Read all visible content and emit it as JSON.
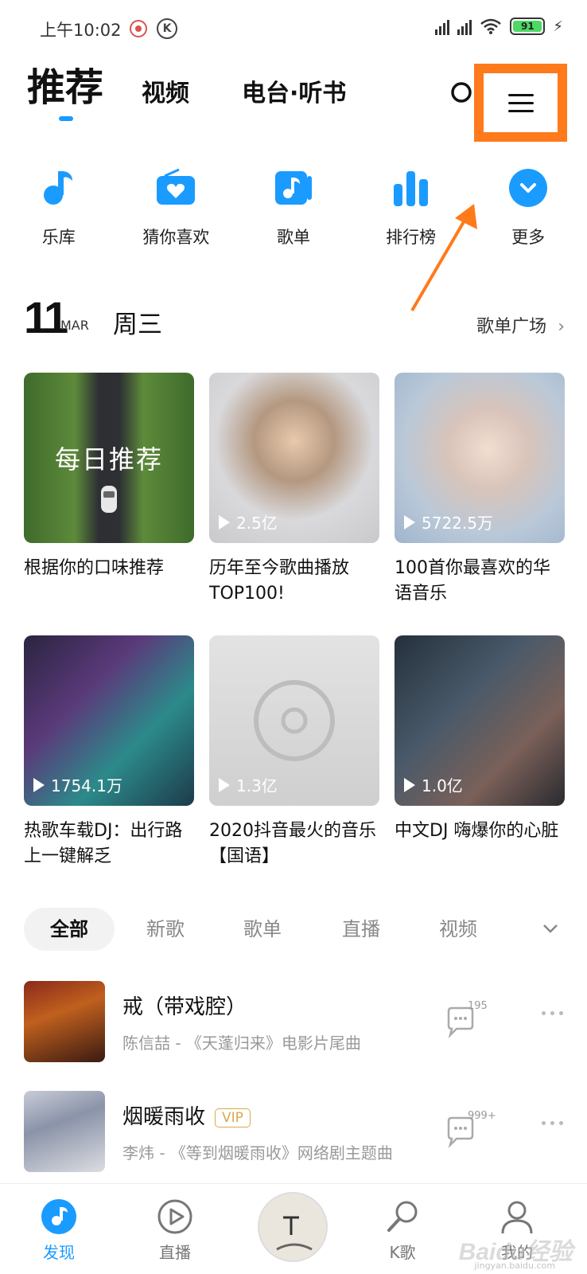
{
  "status_bar": {
    "time": "上午10:02",
    "battery": "91",
    "k_badge": "K"
  },
  "header": {
    "tabs": [
      {
        "label": "推荐",
        "active": true
      },
      {
        "label": "视频",
        "active": false
      },
      {
        "label": "电台·听书",
        "active": false
      }
    ],
    "highlight_color": "#ff7a1a"
  },
  "quick_entries": [
    {
      "label": "乐库",
      "icon": "music-note-icon"
    },
    {
      "label": "猜你喜欢",
      "icon": "radio-heart-icon"
    },
    {
      "label": "歌单",
      "icon": "playlist-icon"
    },
    {
      "label": "排行榜",
      "icon": "bar-chart-icon"
    },
    {
      "label": "更多",
      "icon": "chevron-down-circle-icon"
    }
  ],
  "date": {
    "day": "11",
    "month": "MAR",
    "weekday": "周三",
    "plaza_link": "歌单广场"
  },
  "playlists": [
    {
      "title": "根据你的口味推荐",
      "overlay_text": "每日推荐",
      "play_count": ""
    },
    {
      "title": "历年至今歌曲播放TOP100!",
      "play_count": "2.5亿"
    },
    {
      "title": "100首你最喜欢的华语音乐",
      "play_count": "5722.5万"
    },
    {
      "title": "热歌车载DJ：出行路上一键解乏",
      "play_count": "1754.1万"
    },
    {
      "title": "2020抖音最火的音乐【国语】",
      "play_count": "1.3亿"
    },
    {
      "title": "中文DJ 嗨爆你的心脏",
      "play_count": "1.0亿"
    }
  ],
  "filter_tabs": [
    {
      "label": "全部",
      "active": true
    },
    {
      "label": "新歌",
      "active": false
    },
    {
      "label": "歌单",
      "active": false
    },
    {
      "label": "直播",
      "active": false
    },
    {
      "label": "视频",
      "active": false
    }
  ],
  "songs": [
    {
      "name": "戒（带戏腔）",
      "subtitle": "陈信喆 - 《天蓬归来》电影片尾曲",
      "comments": "195",
      "vip": false
    },
    {
      "name": "烟暖雨收",
      "subtitle": "李炜 - 《等到烟暖雨收》网络剧主题曲",
      "comments": "999+",
      "vip": true,
      "vip_label": "VIP"
    }
  ],
  "bottom_nav": [
    {
      "label": "发现",
      "icon": "discover-icon",
      "active": true
    },
    {
      "label": "直播",
      "icon": "live-play-icon",
      "active": false
    },
    {
      "label": "K歌",
      "icon": "microphone-icon",
      "active": false
    },
    {
      "label": "我的",
      "icon": "profile-icon",
      "active": false
    }
  ],
  "watermark": {
    "text": "Baidu经验",
    "sub": "jingyan.baidu.com"
  },
  "accent_color": "#1a9bff"
}
